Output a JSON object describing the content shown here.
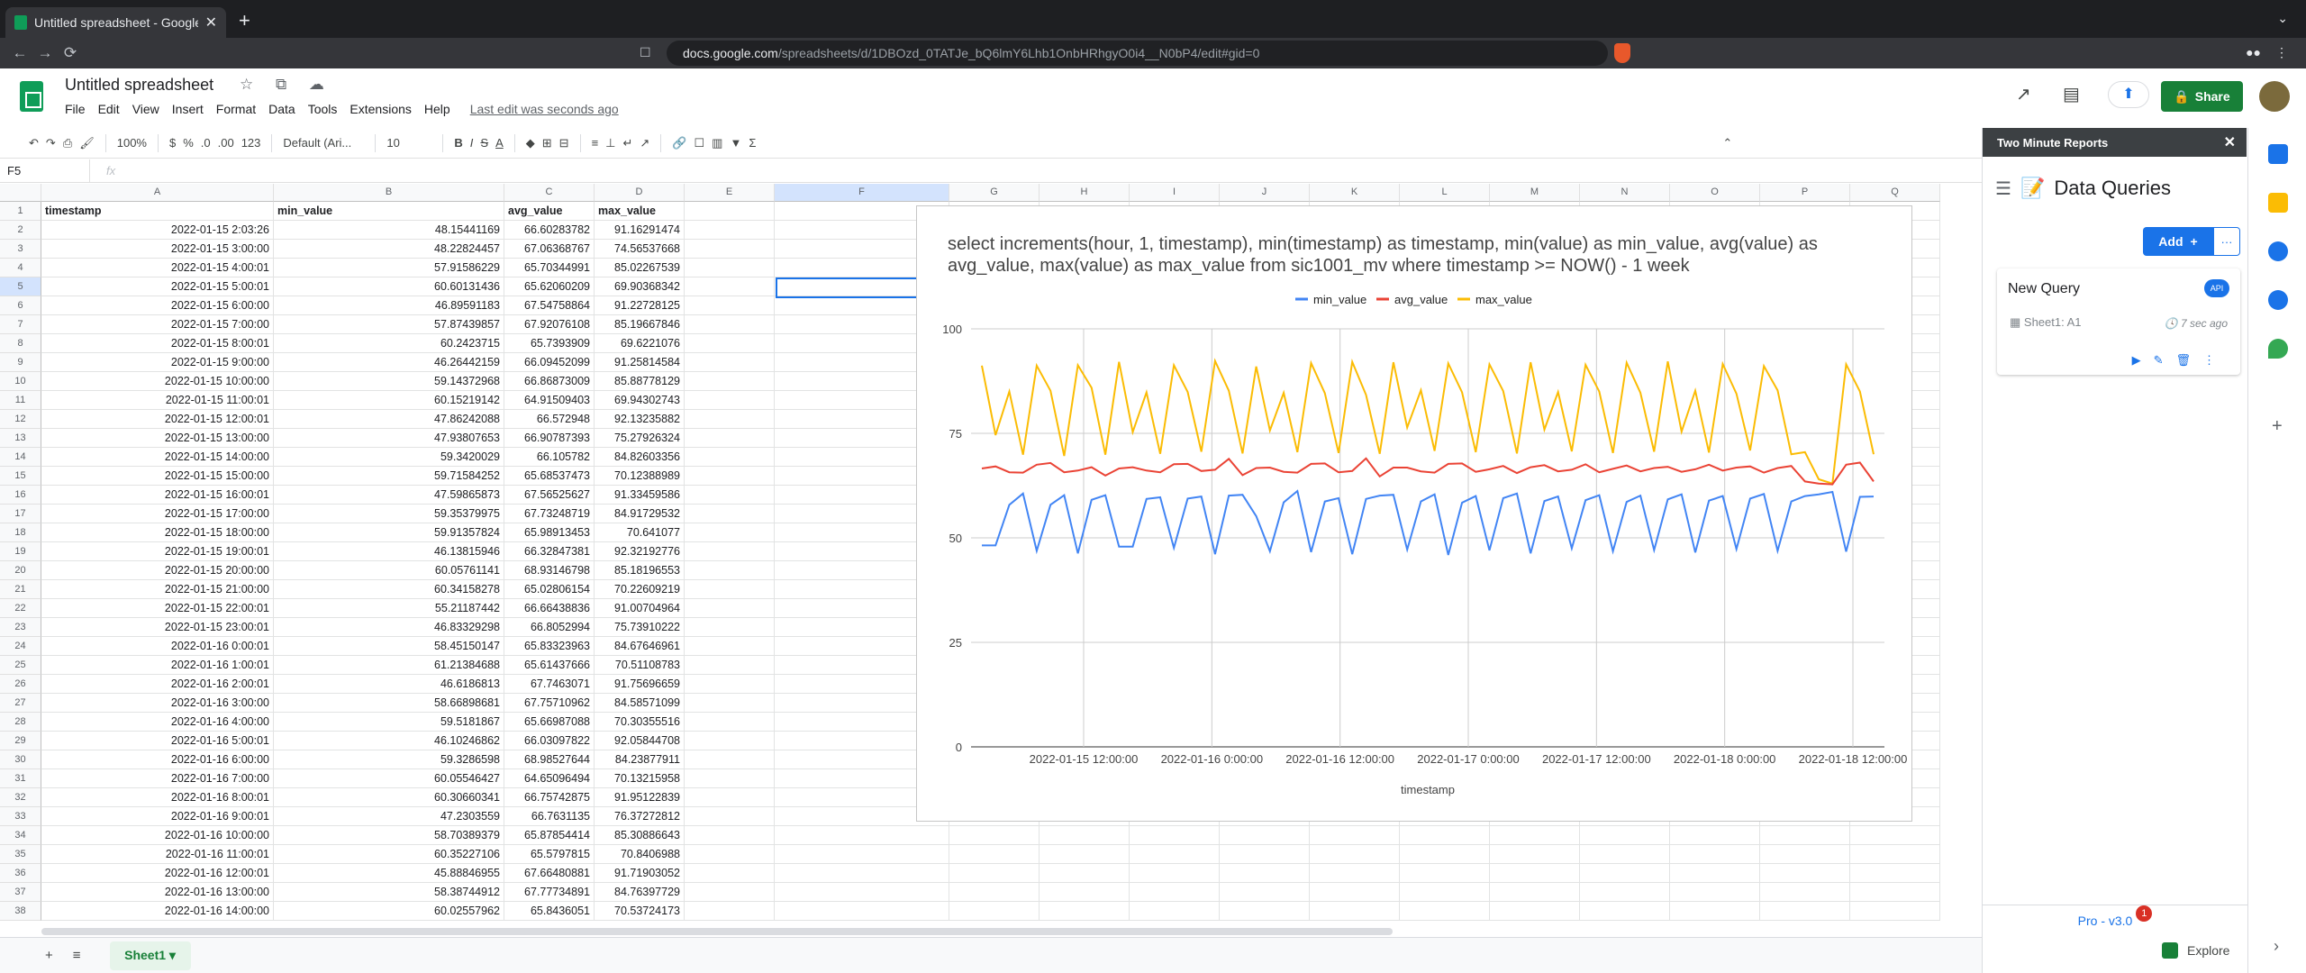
{
  "browser": {
    "tab_title": "Untitled spreadsheet - Google Sheets",
    "tab_close": "✕",
    "new_tab": "+",
    "url_domain": "docs.google.com",
    "url_path": "/spreadsheets/d/1DBOzd_0TATJe_bQ6lmY6Lhb1OnbHRhgyO0i4__N0bP4/edit#gid=0",
    "back": "←",
    "forward": "→",
    "reload": "⟳",
    "bookmark": "☐",
    "window_control": "⌄",
    "ext_icon": "●●",
    "profile_icon": "⋮"
  },
  "doc": {
    "title": "Untitled spreadsheet",
    "title_icons": "☆ ⧉ ☁",
    "menus": [
      "File",
      "Edit",
      "View",
      "Insert",
      "Format",
      "Data",
      "Tools",
      "Extensions",
      "Help"
    ],
    "last_edit": "Last edit was seconds ago",
    "share_label": "Share",
    "share_icon": "🔒",
    "trend_icon": "↗",
    "comment_icon": "▤",
    "present_icon": "⬆"
  },
  "toolbar": {
    "undo": "↶",
    "redo": "↷",
    "print": "⎙",
    "paint": "🖌",
    "zoom": "100%",
    "currency": "$",
    "percent": "%",
    "dec_less": ".0",
    "dec_more": ".00",
    "format_num": "123",
    "font": "Default (Ari...",
    "font_size": "10",
    "bold": "B",
    "italic": "I",
    "strike": "S",
    "textcolor": "A",
    "fill": "◆",
    "borders": "⊞",
    "merge": "⊟",
    "halign": "≡",
    "valign": "⊥",
    "wrap": "↵",
    "rotate": "↗",
    "link": "🔗",
    "comment": "☐",
    "chart": "▥",
    "filter": "▼",
    "functions": "Σ",
    "collapse": "⌃"
  },
  "formula_bar": {
    "cell_ref": "F5",
    "fx": "fx",
    "value": ""
  },
  "grid": {
    "columns": [
      "A",
      "B",
      "C",
      "D",
      "E",
      "F",
      "G",
      "H",
      "I",
      "J",
      "K",
      "L",
      "M",
      "N",
      "O",
      "P",
      "Q"
    ],
    "headers": [
      "timestamp",
      "min_value",
      "avg_value",
      "max_value"
    ],
    "rows": [
      [
        "2022-01-15 2:03:26",
        "48.15441169",
        "66.60283782",
        "91.16291474"
      ],
      [
        "2022-01-15 3:00:00",
        "48.22824457",
        "67.06368767",
        "74.56537668"
      ],
      [
        "2022-01-15 4:00:01",
        "57.91586229",
        "65.70344991",
        "85.02267539"
      ],
      [
        "2022-01-15 5:00:01",
        "60.60131436",
        "65.62060209",
        "69.90368342"
      ],
      [
        "2022-01-15 6:00:00",
        "46.89591183",
        "67.54758864",
        "91.22728125"
      ],
      [
        "2022-01-15 7:00:00",
        "57.87439857",
        "67.92076108",
        "85.19667846"
      ],
      [
        "2022-01-15 8:00:01",
        "60.2423715",
        "65.7393909",
        "69.6221076"
      ],
      [
        "2022-01-15 9:00:00",
        "46.26442159",
        "66.09452099",
        "91.25814584"
      ],
      [
        "2022-01-15 10:00:00",
        "59.14372968",
        "66.86873009",
        "85.88778129"
      ],
      [
        "2022-01-15 11:00:01",
        "60.15219142",
        "64.91509403",
        "69.94302743"
      ],
      [
        "2022-01-15 12:00:01",
        "47.86242088",
        "66.572948",
        "92.13235882"
      ],
      [
        "2022-01-15 13:00:00",
        "47.93807653",
        "66.90787393",
        "75.27926324"
      ],
      [
        "2022-01-15 14:00:00",
        "59.3420029",
        "66.105782",
        "84.82603356"
      ],
      [
        "2022-01-15 15:00:00",
        "59.71584252",
        "65.68537473",
        "70.12388989"
      ],
      [
        "2022-01-15 16:00:01",
        "47.59865873",
        "67.56525627",
        "91.33459586"
      ],
      [
        "2022-01-15 17:00:00",
        "59.35379975",
        "67.73248719",
        "84.91729532"
      ],
      [
        "2022-01-15 18:00:00",
        "59.91357824",
        "65.98913453",
        "70.641077"
      ],
      [
        "2022-01-15 19:00:01",
        "46.13815946",
        "66.32847381",
        "92.32192776"
      ],
      [
        "2022-01-15 20:00:00",
        "60.05761141",
        "68.93146798",
        "85.18196553"
      ],
      [
        "2022-01-15 21:00:00",
        "60.34158278",
        "65.02806154",
        "70.22609219"
      ],
      [
        "2022-01-15 22:00:01",
        "55.21187442",
        "66.66438836",
        "91.00704964"
      ],
      [
        "2022-01-15 23:00:01",
        "46.83329298",
        "66.8052994",
        "75.73910222"
      ],
      [
        "2022-01-16 0:00:01",
        "58.45150147",
        "65.83323963",
        "84.67646961"
      ],
      [
        "2022-01-16 1:00:01",
        "61.21384688",
        "65.61437666",
        "70.51108783"
      ],
      [
        "2022-01-16 2:00:01",
        "46.6186813",
        "67.7463071",
        "91.75696659"
      ],
      [
        "2022-01-16 3:00:00",
        "58.66898681",
        "67.75710962",
        "84.58571099"
      ],
      [
        "2022-01-16 4:00:00",
        "59.5181867",
        "65.66987088",
        "70.30355516"
      ],
      [
        "2022-01-16 5:00:01",
        "46.10246862",
        "66.03097822",
        "92.05844708"
      ],
      [
        "2022-01-16 6:00:00",
        "59.3286598",
        "68.98527644",
        "84.23877911"
      ],
      [
        "2022-01-16 7:00:00",
        "60.05546427",
        "64.65096494",
        "70.13215958"
      ],
      [
        "2022-01-16 8:00:01",
        "60.30660341",
        "66.75742875",
        "91.95122839"
      ],
      [
        "2022-01-16 9:00:01",
        "47.2303559",
        "66.7631135",
        "76.37272812"
      ],
      [
        "2022-01-16 10:00:00",
        "58.70389379",
        "65.87854414",
        "85.30886643"
      ],
      [
        "2022-01-16 11:00:01",
        "60.35227106",
        "65.5797815",
        "70.8406988"
      ],
      [
        "2022-01-16 12:00:01",
        "45.88846955",
        "67.66480881",
        "91.71903052"
      ],
      [
        "2022-01-16 13:00:00",
        "58.38744912",
        "67.77734891",
        "84.76397729"
      ],
      [
        "2022-01-16 14:00:00",
        "60.02557962",
        "65.8436051",
        "70.53724173"
      ]
    ]
  },
  "chart_data": {
    "type": "line",
    "title": "select increments(hour, 1, timestamp), min(timestamp) as timestamp, min(value) as min_value, avg(value) as avg_value, max(value) as max_value from sic1001_mv where timestamp >= NOW() - 1 week",
    "xlabel": "timestamp",
    "ylabel": "",
    "ylim": [
      0,
      100
    ],
    "yticks": [
      "0",
      "25",
      "50",
      "75",
      "100"
    ],
    "xticks": [
      "2022-01-15 12:00:00",
      "2022-01-16 0:00:00",
      "2022-01-16 12:00:00",
      "2022-01-17 0:00:00",
      "2022-01-17 12:00:00",
      "2022-01-18 0:00:00",
      "2022-01-18 12:00:00"
    ],
    "legend_position": "top",
    "grid": true,
    "series": [
      {
        "name": "min_value",
        "color": "#4285f4",
        "values": [
          48.2,
          48.2,
          57.9,
          60.6,
          46.9,
          57.9,
          60.2,
          46.3,
          59.1,
          60.2,
          47.9,
          47.9,
          59.3,
          59.7,
          47.6,
          59.4,
          59.9,
          46.1,
          60.1,
          60.3,
          55.2,
          46.8,
          58.5,
          61.2,
          46.6,
          58.7,
          59.5,
          46.1,
          59.3,
          60.1,
          60.3,
          47.2,
          58.7,
          60.4,
          45.9,
          58.4,
          60.0,
          47.0,
          59.5,
          60.6,
          46.3,
          58.8,
          59.9,
          47.5,
          59.0,
          60.2,
          46.8,
          58.6,
          60.1,
          47.1,
          59.2,
          60.4,
          46.5,
          58.9,
          60.0,
          47.3,
          59.4,
          60.5,
          46.9,
          58.7,
          60.0,
          60.4,
          61.0,
          46.7,
          59.8,
          59.9
        ]
      },
      {
        "name": "avg_value",
        "color": "#ea4335",
        "values": [
          66.6,
          67.1,
          65.7,
          65.6,
          67.5,
          67.9,
          65.7,
          66.1,
          66.9,
          64.9,
          66.6,
          66.9,
          66.1,
          65.7,
          67.6,
          67.7,
          66.0,
          66.3,
          68.9,
          65.0,
          66.7,
          66.8,
          65.8,
          65.6,
          67.7,
          67.8,
          65.7,
          66.0,
          69.0,
          64.7,
          66.8,
          66.8,
          65.9,
          65.6,
          67.7,
          67.8,
          65.8,
          66.4,
          67.2,
          65.5,
          66.9,
          67.4,
          65.9,
          66.3,
          67.6,
          65.7,
          66.5,
          67.3,
          65.9,
          66.7,
          67.0,
          65.8,
          66.4,
          67.5,
          66.1,
          66.8,
          67.1,
          65.6,
          66.7,
          67.2,
          63.5,
          63.0,
          62.8,
          67.5,
          68.0,
          63.5
        ]
      },
      {
        "name": "max_value",
        "color": "#fbbc04",
        "values": [
          91.2,
          74.6,
          85.0,
          69.9,
          91.2,
          85.2,
          69.6,
          91.3,
          85.9,
          69.9,
          92.1,
          75.3,
          84.8,
          70.1,
          91.3,
          84.9,
          70.6,
          92.3,
          85.2,
          70.2,
          91.0,
          75.7,
          84.7,
          70.5,
          91.8,
          84.6,
          70.3,
          92.1,
          84.2,
          70.1,
          92.0,
          76.4,
          85.3,
          70.8,
          91.7,
          84.8,
          70.5,
          91.5,
          85.1,
          70.2,
          92.0,
          75.9,
          84.9,
          70.7,
          91.4,
          85.0,
          70.3,
          91.9,
          84.7,
          70.6,
          92.2,
          75.4,
          85.2,
          70.4,
          91.6,
          84.5,
          70.9,
          91.1,
          85.3,
          70.0,
          70.5,
          64.0,
          63.0,
          91.5,
          85.0,
          70.0
        ]
      }
    ]
  },
  "panel": {
    "header": "Two Minute Reports",
    "close": "✕",
    "menu_icon": "☰",
    "title_icon": "📝",
    "title": "Data Queries",
    "add_label": "Add",
    "add_icon": "+",
    "more": "···",
    "query_name": "New Query",
    "api_badge": "API",
    "query_range": "▦ Sheet1: A1",
    "query_time": "🕓 7 sec ago",
    "query_actions": "▶✎🗑⋮",
    "version": "Pro - v3.0",
    "notif_count": "1"
  },
  "footer": {
    "add_sheet": "+",
    "all_sheets": "≡",
    "sheet_tab": "Sheet1 ▾",
    "explore": "Explore",
    "collapse_panel": "›"
  }
}
